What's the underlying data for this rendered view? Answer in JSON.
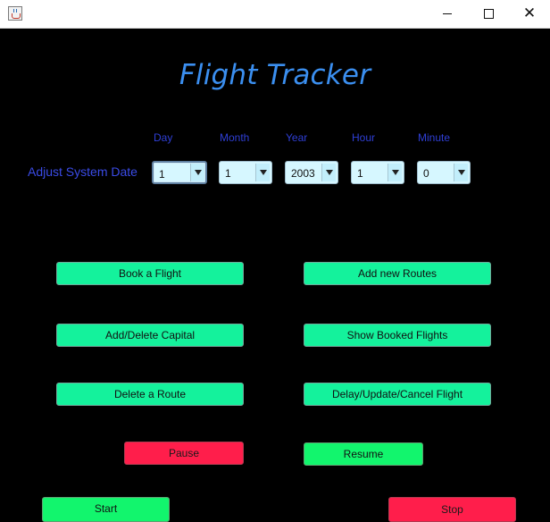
{
  "window": {
    "app_icon": "java-cup-icon",
    "controls": {
      "minimize": "minimize-icon",
      "maximize": "maximize-icon",
      "close": "close-icon",
      "close_glyph": "✕"
    }
  },
  "title": "Flight Tracker",
  "date_adjust": {
    "label": "Adjust System Date",
    "fields": {
      "day": {
        "label": "Day",
        "value": "1"
      },
      "month": {
        "label": "Month",
        "value": "1"
      },
      "year": {
        "label": "Year",
        "value": "2003"
      },
      "hour": {
        "label": "Hour",
        "value": "1"
      },
      "minute": {
        "label": "Minute",
        "value": "0"
      }
    }
  },
  "actions": {
    "book_flight": "Book a Flight",
    "add_routes": "Add new Routes",
    "add_delete_capital": "Add/Delete Capital",
    "show_booked": "Show Booked Flights",
    "delete_route": "Delete a Route",
    "delay_update_cancel": "Delay/Update/Cancel Flight"
  },
  "controls": {
    "pause": "Pause",
    "resume": "Resume",
    "start": "Start",
    "stop": "Stop"
  },
  "colors": {
    "background": "#000000",
    "title": "#3b8ff0",
    "label": "#2f3fd6",
    "combo_bg": "#d6f7ff",
    "action_button": "#14f29c",
    "go_button": "#12f56d",
    "halt_button": "#ff1e4b"
  }
}
